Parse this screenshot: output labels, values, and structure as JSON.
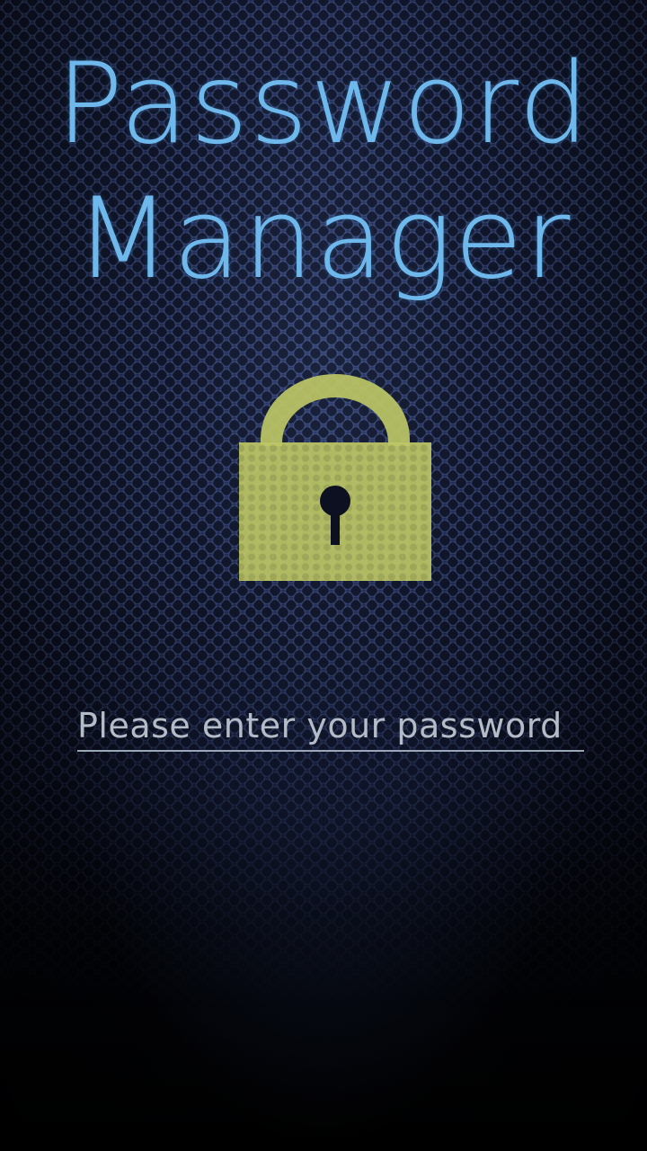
{
  "app": {
    "title_line1": "Password",
    "title_line2": "Manager"
  },
  "lock": {
    "icon": "padlock-icon",
    "color": "#bdc766"
  },
  "login": {
    "password_placeholder": "Please enter your password",
    "password_value": ""
  },
  "colors": {
    "title": "#6fb8ec",
    "background_top": "#1b2547",
    "background_bottom": "#000000"
  }
}
